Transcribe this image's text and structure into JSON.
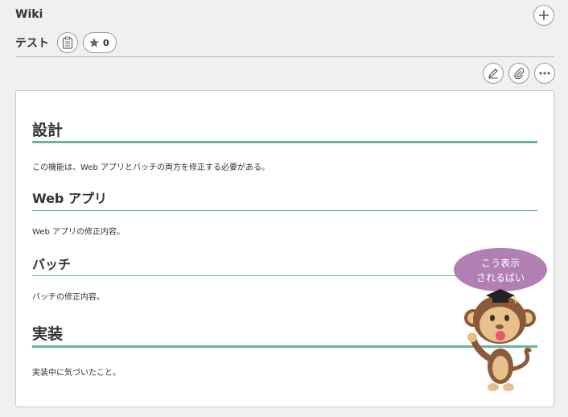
{
  "header": {
    "title": "Wiki"
  },
  "page": {
    "name": "テスト",
    "star_count": "0"
  },
  "content": {
    "section1_heading": "設計",
    "section1_text": "この機能は、Web アプリとバッチの両方を修正する必要がある。",
    "section2_heading": "Web アプリ",
    "section2_text": "Web アプリの修正内容。",
    "section3_heading": "バッチ",
    "section3_text": "バッチの修正内容。",
    "section4_heading": "実装",
    "section4_text": "実装中に気づいたこと。"
  },
  "mascot": {
    "bubble_line1": "こう表示",
    "bubble_line2": "されるばい"
  },
  "colors": {
    "accent": "#6db39a",
    "bubble": "#b27fb5"
  },
  "icons": [
    "add-icon",
    "clipboard-icon",
    "star-icon",
    "pencil-icon",
    "paperclip-icon",
    "more-icon"
  ]
}
